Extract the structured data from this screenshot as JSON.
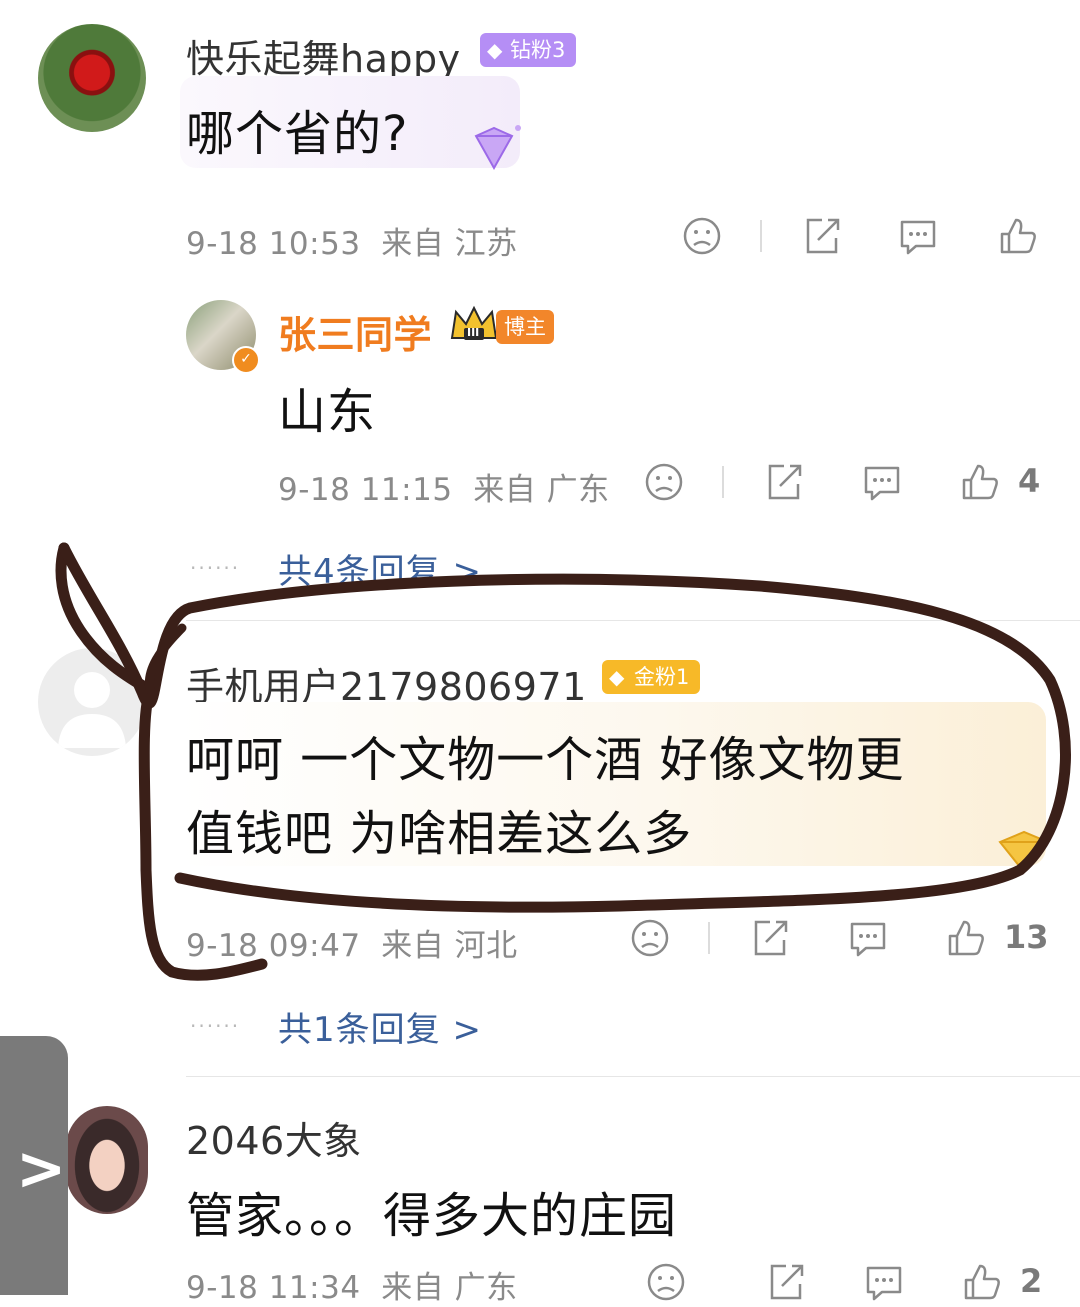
{
  "comments": [
    {
      "name": "快乐起舞happy",
      "badge": "钻粉3",
      "content": "哪个省的?",
      "time": "9-18 10:53",
      "location": "来自 江苏",
      "like_count": ""
    },
    {
      "name": "张三同学",
      "badge_level": "III",
      "badge": "博主",
      "content": "山东",
      "time": "9-18 11:15",
      "location": "来自 广东",
      "like_count": "4",
      "replies": "共4条回复 >"
    },
    {
      "name": "手机用户2179806971",
      "badge": "金粉1",
      "content_line1": "呵呵 一个文物一个酒 好像文物更",
      "content_line2": "值钱吧 为啥相差这么多",
      "time": "9-18 09:47",
      "location": "来自 河北",
      "like_count": "13",
      "replies": "共1条回复 >"
    },
    {
      "name": "2046大象",
      "content": "管家。。。得多大的庄园",
      "time": "9-18 11:34",
      "location": "来自 广东",
      "like_count": "2"
    }
  ],
  "side_tab": {
    "chevron": ">"
  },
  "dots": "......",
  "colors": {
    "reply_link": "#3a5f9a",
    "blogger_name": "#f07c1f",
    "diamond_badge": "#a77bf0",
    "gold_badge": "#f5b420",
    "annotation_stroke": "#3a1f18"
  },
  "icons": [
    "dislike-icon",
    "share-icon",
    "comment-icon",
    "like-icon"
  ]
}
